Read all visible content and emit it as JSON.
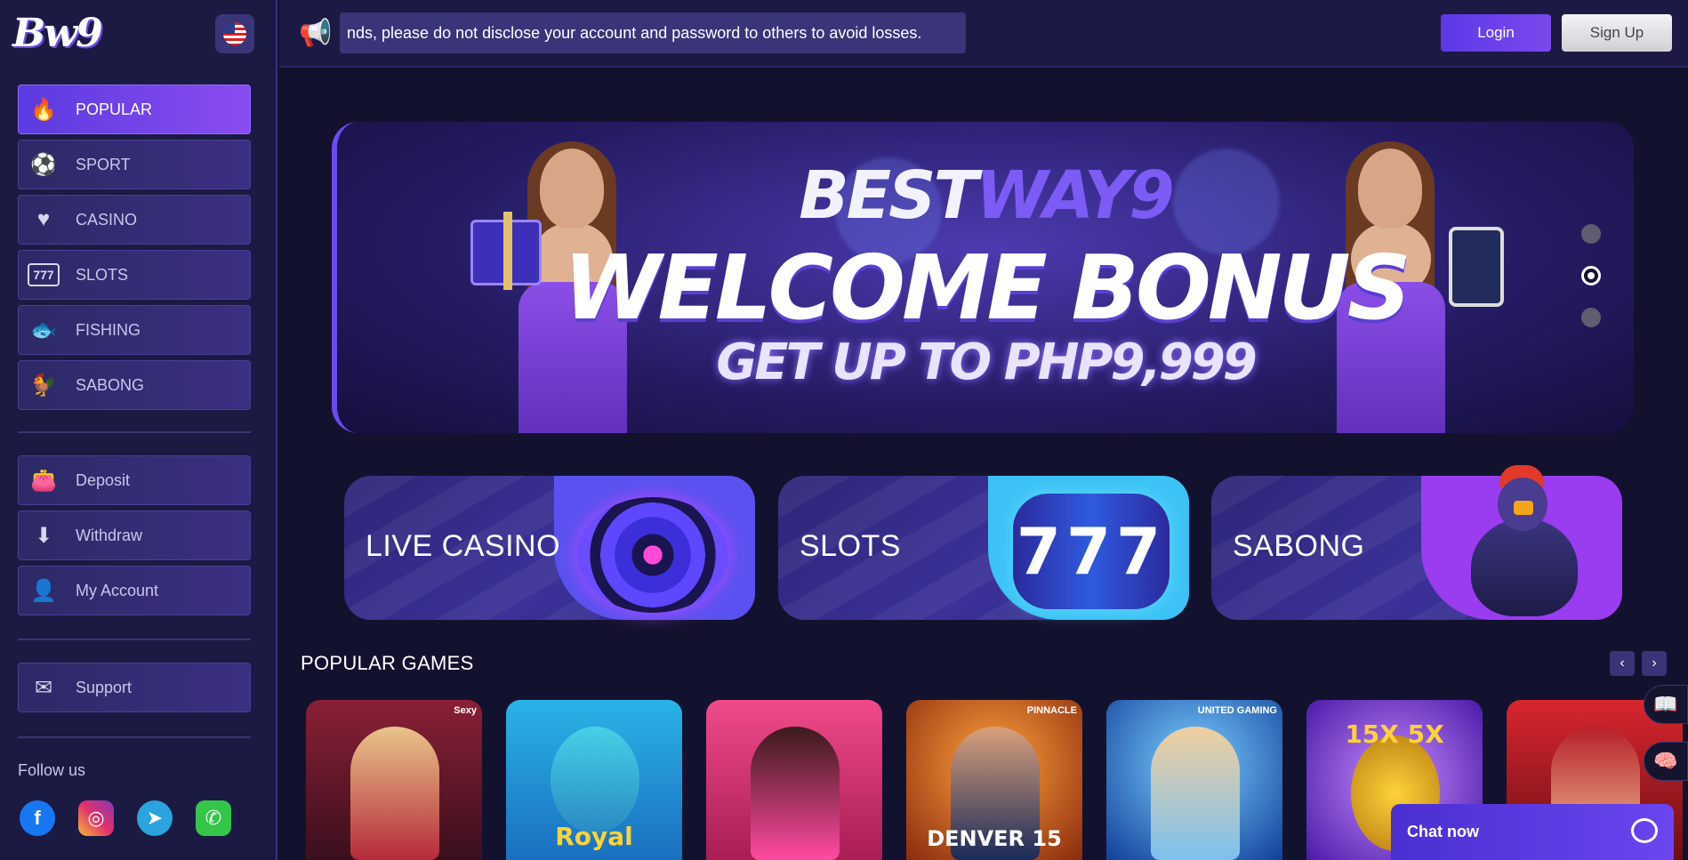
{
  "brand": {
    "logo_text": "Bw9",
    "flag": "us-flag-icon"
  },
  "topbar": {
    "notice": "nds, please do not disclose your account and password to others to avoid losses.",
    "login_label": "Login",
    "signup_label": "Sign Up"
  },
  "sidebar": {
    "main_items": [
      {
        "label": "POPULAR",
        "icon": "flame-icon",
        "active": true
      },
      {
        "label": "SPORT",
        "icon": "soccer-ball-icon"
      },
      {
        "label": "CASINO",
        "icon": "card-heart-icon"
      },
      {
        "label": "SLOTS",
        "icon": "slot-777-icon"
      },
      {
        "label": "FISHING",
        "icon": "fish-icon"
      },
      {
        "label": "SABONG",
        "icon": "rooster-icon"
      }
    ],
    "account_items": [
      {
        "label": "Deposit",
        "icon": "wallet-icon"
      },
      {
        "label": "Withdraw",
        "icon": "atm-icon"
      },
      {
        "label": "My Account",
        "icon": "user-icon"
      }
    ],
    "support_item": {
      "label": "Support",
      "icon": "mail-icon"
    },
    "follow_label": "Follow us",
    "socials": [
      {
        "name": "facebook-icon",
        "glyph": "f"
      },
      {
        "name": "instagram-icon",
        "glyph": "◎"
      },
      {
        "name": "telegram-icon",
        "glyph": "➤"
      },
      {
        "name": "whatsapp-icon",
        "glyph": "✆"
      }
    ]
  },
  "banner": {
    "title_white": "BEST",
    "title_purple": "WAY9",
    "headline": "WELCOME BONUS",
    "subline": "GET UP TO PHP9,999",
    "slides": 3,
    "active_slide": 2
  },
  "categories": [
    {
      "label": "LIVE CASINO",
      "accent": "#5a52f0"
    },
    {
      "label": "SLOTS",
      "accent": "#3cc2f5"
    },
    {
      "label": "SABONG",
      "accent": "#9a3cf0"
    }
  ],
  "popular_games": {
    "title": "POPULAR GAMES",
    "prev": "‹",
    "next": "›",
    "tiles": [
      {
        "provider": "Sexy",
        "number": "",
        "bg": "#6a1a2e"
      },
      {
        "provider": "",
        "number": "Royal",
        "bg": "#1f8fd6"
      },
      {
        "provider": "",
        "number": "",
        "bg": "#e23c7a"
      },
      {
        "provider": "PINNACLE",
        "number": "DENVER 15",
        "bg": "#c2461d"
      },
      {
        "provider": "UNITED GAMING",
        "number": "",
        "bg": "#1e5fc8"
      },
      {
        "provider": "",
        "number": "15X  5X",
        "bg": "#6a2ad0"
      },
      {
        "provider": "",
        "number": "",
        "bg": "#b81f2a"
      }
    ]
  },
  "widgets": {
    "chat_label": "Chat now",
    "book_icon": "book-icon",
    "brain_icon": "brain-icon"
  }
}
